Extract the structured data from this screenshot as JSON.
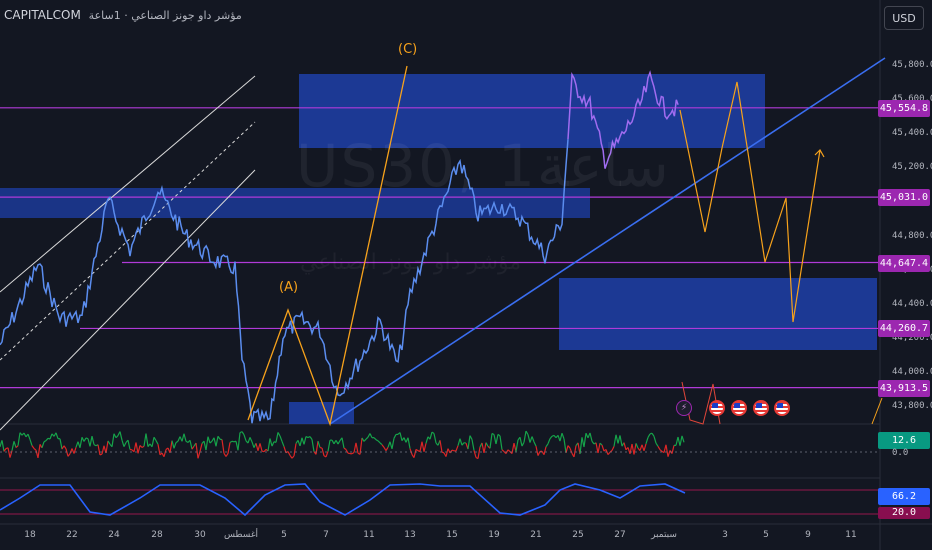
{
  "header": {
    "symbol": "CAPITALCOM",
    "description": "مؤشر داو جونز الصناعي · 1ساعة",
    "currency_button": "USD"
  },
  "watermark": {
    "main": "US30, 1ساعة",
    "sub": "مؤشر داو جونز الصناعي"
  },
  "wave_labels": {
    "a": "(A)",
    "c": "(C)"
  },
  "price_axis": {
    "min": 43600,
    "max": 45900,
    "ticks": [
      "45,800.0",
      "45,600.0",
      "45,400.0",
      "45,200.0",
      "44,800.0",
      "44,600.0",
      "44,400.0",
      "44,200.0",
      "44,000.0",
      "43,800.0"
    ],
    "tick_values": [
      45800,
      45600,
      45400,
      45200,
      44800,
      44600,
      44400,
      44200,
      44000,
      43800
    ]
  },
  "price_tags": [
    {
      "label": "45,554.8",
      "value": 45554.8,
      "color": "#9c27b0"
    },
    {
      "label": "45,031.0",
      "value": 45031.0,
      "color": "#9c27b0"
    },
    {
      "label": "44,647.4",
      "value": 44647.4,
      "color": "#9c27b0"
    },
    {
      "label": "44,260.7",
      "value": 44260.7,
      "color": "#9c27b0"
    },
    {
      "label": "43,913.5",
      "value": 43913.5,
      "color": "#9c27b0"
    }
  ],
  "indicators": {
    "rsi_value": "12.6",
    "rsi_zero": "0.0",
    "osc_value": "66.2",
    "osc_low": "20.0"
  },
  "time_axis": {
    "labels": [
      "18",
      "22",
      "24",
      "28",
      "30",
      "أغسطس",
      "5",
      "7",
      "11",
      "13",
      "15",
      "19",
      "21",
      "25",
      "27",
      "سبتمبر",
      "3",
      "5",
      "9",
      "11"
    ]
  },
  "colors": {
    "background": "#131722",
    "zone_blue": "#1e3fa8",
    "level_purple": "#b03ad8",
    "wave_orange": "#f7a21b",
    "trend_blue": "#3a6ef0",
    "price_line": "#5b8def",
    "price_line_recent": "#a06cf0",
    "channel_white": "#d9d9d9",
    "rsi_green": "#16a34a",
    "rsi_red": "#dc2626",
    "osc_blue": "#2962ff"
  },
  "events": [
    {
      "icon": "flash-icon"
    },
    {
      "icon": "us-flag-icon"
    },
    {
      "icon": "us-flag-icon"
    },
    {
      "icon": "us-flag-icon"
    },
    {
      "icon": "us-flag-icon"
    }
  ]
}
